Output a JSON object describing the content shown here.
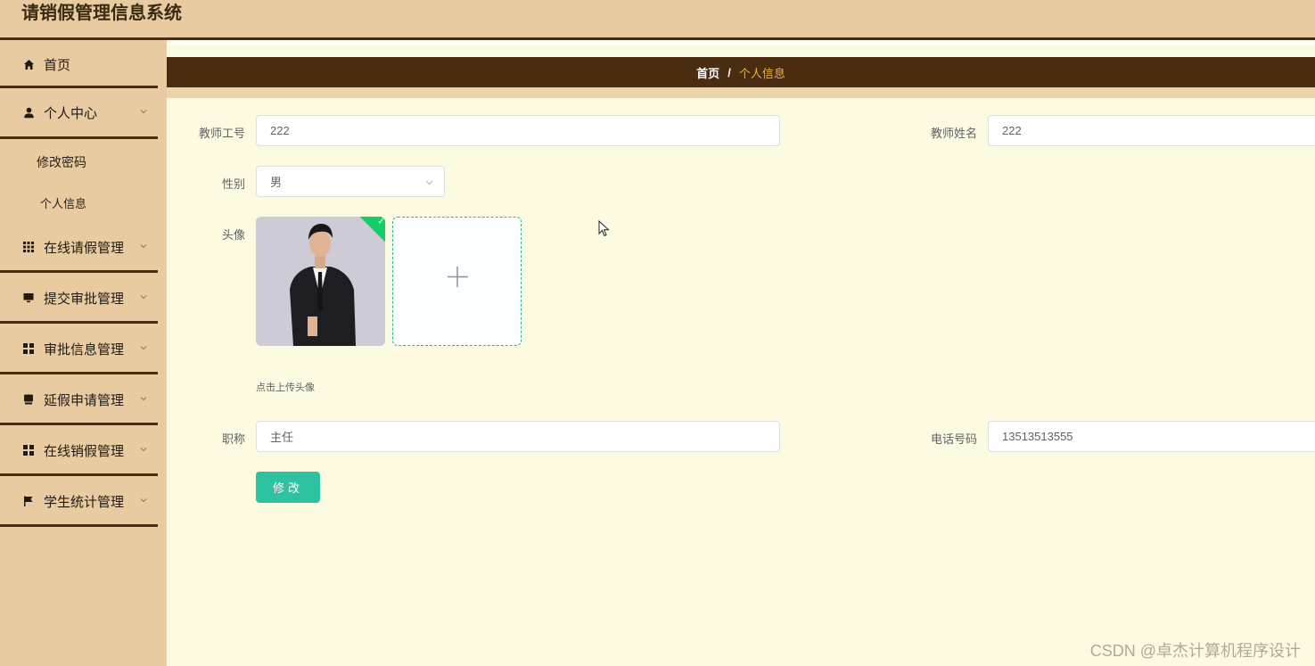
{
  "app": {
    "title": "请销假管理信息系统"
  },
  "sidebar": {
    "items": [
      {
        "label": "首页",
        "icon": "home-icon"
      },
      {
        "label": "个人中心",
        "icon": "user-icon",
        "expandable": true
      },
      {
        "label": "修改密码",
        "sub": true
      },
      {
        "label": "个人信息",
        "sub": true,
        "active": true
      },
      {
        "label": "在线请假管理",
        "icon": "grid-icon",
        "expandable": true
      },
      {
        "label": "提交审批管理",
        "icon": "monitor-icon",
        "expandable": true
      },
      {
        "label": "审批信息管理",
        "icon": "apps-icon",
        "expandable": true
      },
      {
        "label": "延假申请管理",
        "icon": "tablet-icon",
        "expandable": true
      },
      {
        "label": "在线销假管理",
        "icon": "apps-icon",
        "expandable": true
      },
      {
        "label": "学生统计管理",
        "icon": "flag-icon",
        "expandable": true
      }
    ]
  },
  "breadcrumb": {
    "home": "首页",
    "separator": "/",
    "current": "个人信息"
  },
  "form": {
    "teacher_id": {
      "label": "教师工号",
      "value": "222"
    },
    "teacher_name": {
      "label": "教师姓名",
      "value": "222"
    },
    "gender": {
      "label": "性别",
      "value": "男"
    },
    "avatar": {
      "label": "头像",
      "hint": "点击上传头像",
      "uploaded": true
    },
    "title": {
      "label": "职称",
      "value": "主任"
    },
    "phone": {
      "label": "电话号码",
      "value": "13513513555"
    },
    "submit_label": "修改"
  },
  "watermark": "CSDN @卓杰计算机程序设计",
  "colors": {
    "topbar": "#e8cba0",
    "nav_dark": "#4a2c10",
    "breadcrumb_active": "#e7b53b",
    "button": "#2ec3a0",
    "background": "#fdfae2"
  }
}
